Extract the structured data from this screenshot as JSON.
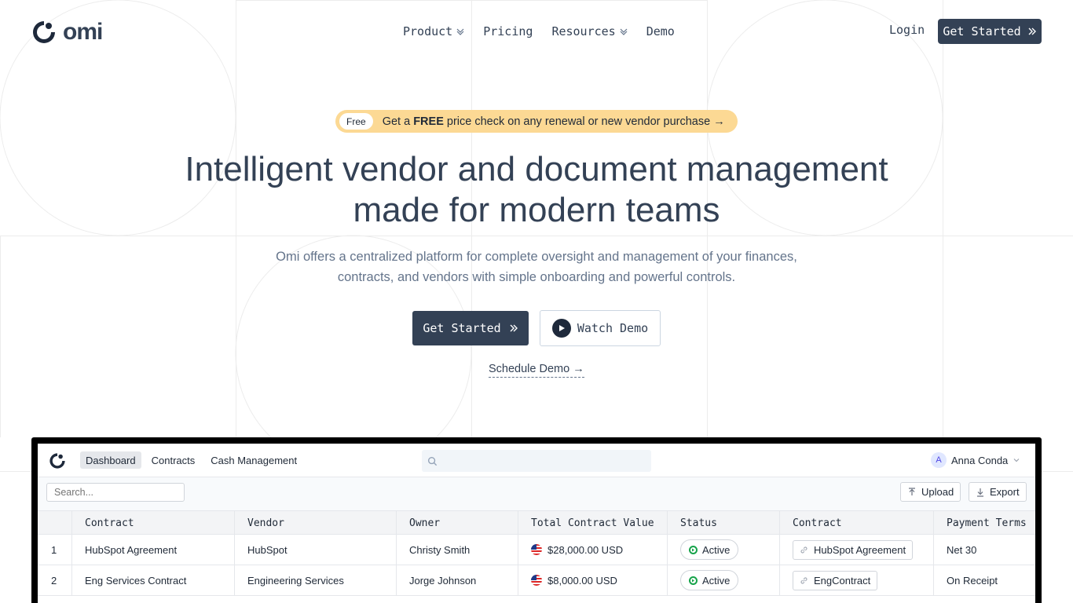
{
  "brand": {
    "name": "omi"
  },
  "nav": {
    "items": [
      {
        "label": "Product",
        "has_dropdown": true
      },
      {
        "label": "Pricing",
        "has_dropdown": false
      },
      {
        "label": "Resources",
        "has_dropdown": true
      },
      {
        "label": "Demo",
        "has_dropdown": false
      }
    ],
    "login": "Login",
    "cta": "Get Started"
  },
  "banner": {
    "badge": "Free",
    "text_before": "Get a ",
    "text_bold": "FREE",
    "text_after": " price check on any renewal or new vendor purchase →"
  },
  "hero": {
    "title_line1": "Intelligent vendor and document management",
    "title_line2": "made for modern teams",
    "subtitle_line1": "Omi offers a centralized platform for complete oversight and management of your finances,",
    "subtitle_line2": "contracts, and vendors with simple onboarding and powerful controls.",
    "primary_cta": "Get Started",
    "secondary_cta": "Watch Demo",
    "schedule_link": "Schedule Demo →"
  },
  "app": {
    "tabs": [
      "Dashboard",
      "Contracts",
      "Cash Management"
    ],
    "active_tab": "Dashboard",
    "user": {
      "initial": "A",
      "name": "Anna Conda"
    },
    "toolbar": {
      "search_placeholder": "Search...",
      "upload": "Upload",
      "export": "Export"
    },
    "table": {
      "columns": [
        "Contract",
        "Vendor",
        "Owner",
        "Total Contract Value",
        "Status",
        "Contract",
        "Payment Terms"
      ],
      "rows": [
        {
          "num": "1",
          "contract": "HubSpot Agreement",
          "vendor": "HubSpot",
          "owner": "Christy Smith",
          "value": "$28,000.00 USD",
          "status": "Active",
          "file": "HubSpot Agreement",
          "terms": "Net 30"
        },
        {
          "num": "2",
          "contract": "Eng Services Contract",
          "vendor": "Engineering Services",
          "owner": "Jorge Johnson",
          "value": "$8,000.00 USD",
          "status": "Active",
          "file": "EngContract",
          "terms": "On Receipt"
        }
      ]
    }
  },
  "colors": {
    "primary": "#334155",
    "banner": "#fcd994",
    "status_active": "#16a34a"
  }
}
